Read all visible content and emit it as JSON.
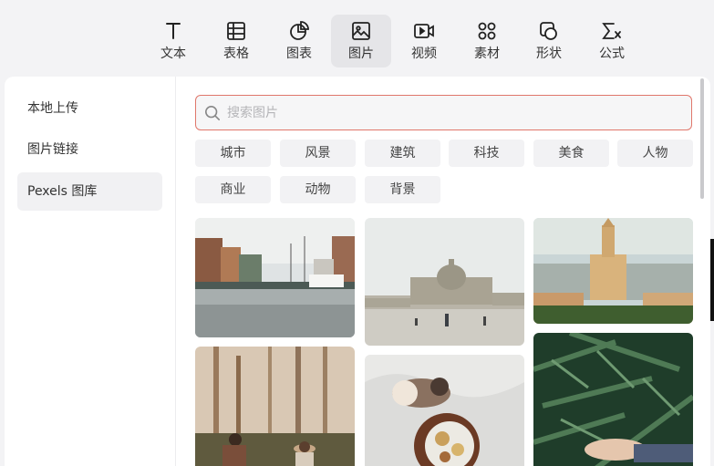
{
  "toolbar": {
    "items": [
      {
        "label": "文本",
        "icon": "text-icon"
      },
      {
        "label": "表格",
        "icon": "table-icon"
      },
      {
        "label": "图表",
        "icon": "chart-icon"
      },
      {
        "label": "图片",
        "icon": "image-icon",
        "active": true
      },
      {
        "label": "视频",
        "icon": "video-icon"
      },
      {
        "label": "素材",
        "icon": "material-icon"
      },
      {
        "label": "形状",
        "icon": "shape-icon"
      },
      {
        "label": "公式",
        "icon": "formula-icon"
      }
    ]
  },
  "sidebar": {
    "items": [
      {
        "label": "本地上传"
      },
      {
        "label": "图片链接"
      },
      {
        "label": "Pexels 图库",
        "active": true
      }
    ]
  },
  "search": {
    "placeholder": "搜索图片",
    "value": ""
  },
  "tags": [
    "城市",
    "风景",
    "建筑",
    "科技",
    "美食",
    "人物",
    "商业",
    "动物",
    "背景"
  ],
  "photos": [
    {
      "subject": "canal-city-photo"
    },
    {
      "subject": "cathedral-square-photo"
    },
    {
      "subject": "church-tower-photo"
    },
    {
      "subject": "forest-people-photo"
    },
    {
      "subject": "cat-breakfast-photo"
    },
    {
      "subject": "fern-leaves-photo"
    }
  ],
  "colors": {
    "accent": "#e0776b",
    "active_bg": "#e5e5e8"
  }
}
